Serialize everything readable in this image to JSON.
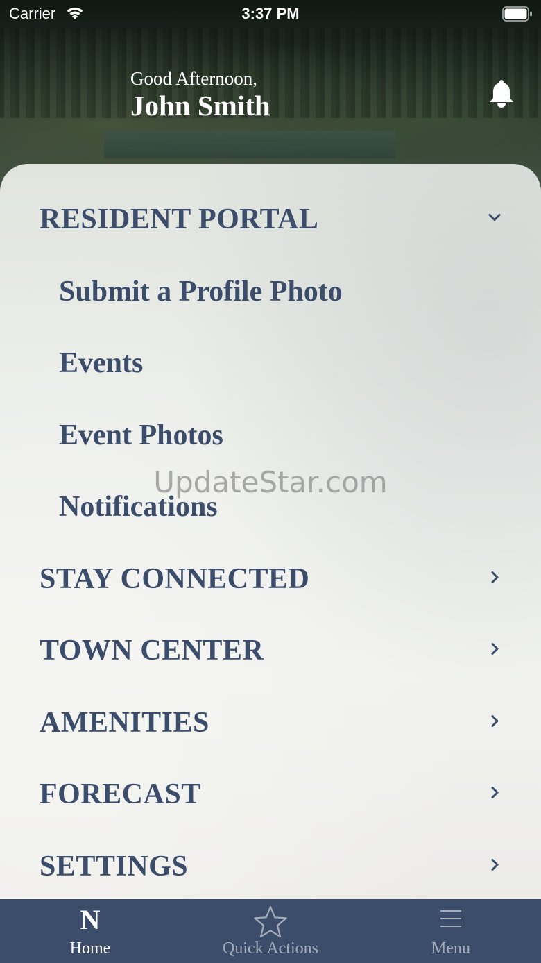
{
  "status_bar": {
    "carrier": "Carrier",
    "time": "3:37 PM"
  },
  "header": {
    "greeting": "Good Afternoon,",
    "user_name": "John Smith"
  },
  "menu": {
    "sections": [
      {
        "label": "RESIDENT PORTAL",
        "expanded": true,
        "icon": "chevron-down-icon",
        "items": [
          {
            "label": "Submit a Profile Photo"
          },
          {
            "label": "Events"
          },
          {
            "label": "Event Photos"
          },
          {
            "label": "Notifications"
          }
        ]
      },
      {
        "label": "STAY CONNECTED",
        "expanded": false,
        "icon": "chevron-right-icon"
      },
      {
        "label": "TOWN CENTER",
        "expanded": false,
        "icon": "chevron-right-icon"
      },
      {
        "label": "AMENITIES",
        "expanded": false,
        "icon": "chevron-right-icon"
      },
      {
        "label": "FORECAST",
        "expanded": false,
        "icon": "chevron-right-icon"
      },
      {
        "label": "SETTINGS",
        "expanded": false,
        "icon": "chevron-right-icon"
      }
    ]
  },
  "watermark": "UpdateStar.com",
  "tab_bar": {
    "tabs": [
      {
        "label": "Home",
        "icon": "N",
        "active": true
      },
      {
        "label": "Quick Actions",
        "icon": "star-icon",
        "active": false
      },
      {
        "label": "Menu",
        "icon": "hamburger-icon",
        "active": false
      }
    ]
  },
  "colors": {
    "accent_navy": "#3b4d6b",
    "tab_inactive": "#a5adb9",
    "panel_bg": "#eceeeb"
  }
}
